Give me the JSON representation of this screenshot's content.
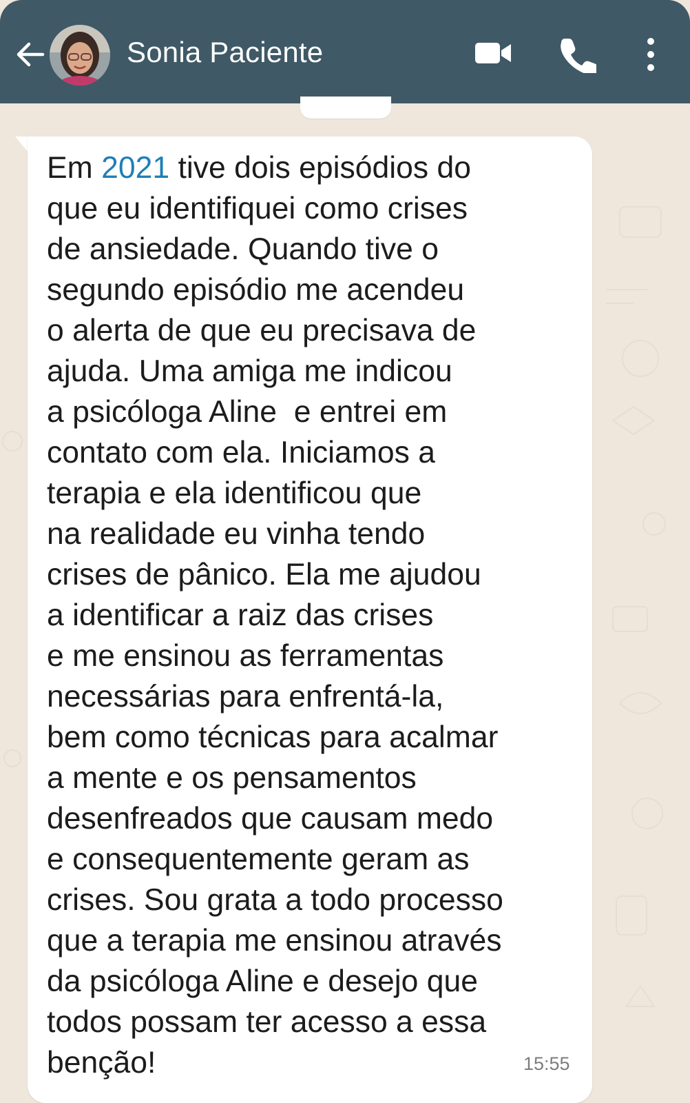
{
  "header": {
    "contact_name": "Sonia Paciente",
    "background_color": "#3f5966",
    "icons": [
      "back-arrow-icon",
      "avatar",
      "video-call-icon",
      "voice-call-icon",
      "more-options-icon"
    ]
  },
  "message": {
    "lines": [
      {
        "before": "Em ",
        "link": "2021",
        "after": " tive dois episódios do"
      },
      {
        "text": "que eu identifiquei como crises"
      },
      {
        "text": "de ansiedade. Quando tive o"
      },
      {
        "text": "segundo episódio me acendeu"
      },
      {
        "text": "o alerta de que eu precisava de"
      },
      {
        "text": "ajuda. Uma amiga me indicou"
      },
      {
        "text": "a psicóloga Aline  e entrei em"
      },
      {
        "text": "contato com ela. Iniciamos a"
      },
      {
        "text": "terapia e ela identificou que"
      },
      {
        "text": "na realidade eu vinha tendo"
      },
      {
        "text": "crises de pânico. Ela me ajudou"
      },
      {
        "text": "a identificar a raiz das crises"
      },
      {
        "text": "e me ensinou as ferramentas"
      },
      {
        "text": "necessárias para enfrentá-la,"
      },
      {
        "text": "bem como técnicas para acalmar"
      },
      {
        "text": "a mente e os pensamentos"
      },
      {
        "text": "desenfreados que causam medo"
      },
      {
        "text": "e consequentemente geram as"
      },
      {
        "text": "crises. Sou grata a todo processo"
      },
      {
        "text": "que a terapia me ensinou através"
      },
      {
        "text": "da psicóloga Aline e desejo que"
      },
      {
        "text": "todos possam ter acesso a essa"
      },
      {
        "text": "benção!"
      }
    ],
    "time": "15:55",
    "link_color": "#1f7fb6"
  }
}
